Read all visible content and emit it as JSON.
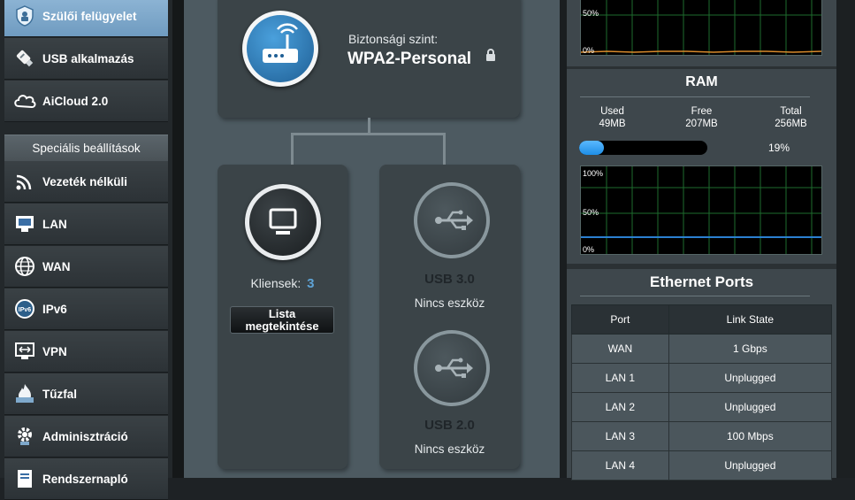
{
  "sidebar": {
    "items": [
      {
        "label": "Szülői felügyelet",
        "icon": "parental-control-icon",
        "active": true
      },
      {
        "label": "USB alkalmazás",
        "icon": "usb-stick-icon"
      },
      {
        "label": "AiCloud 2.0",
        "icon": "cloud-icon"
      }
    ],
    "section_header": "Speciális beállítások",
    "advanced_items": [
      {
        "label": "Vezeték nélküli",
        "icon": "wireless-icon"
      },
      {
        "label": "LAN",
        "icon": "lan-icon"
      },
      {
        "label": "WAN",
        "icon": "globe-icon"
      },
      {
        "label": "IPv6",
        "icon": "ipv6-icon"
      },
      {
        "label": "VPN",
        "icon": "vpn-icon"
      },
      {
        "label": "Tűzfal",
        "icon": "firewall-icon"
      },
      {
        "label": "Adminisztráció",
        "icon": "gear-icon"
      },
      {
        "label": "Rendszernapló",
        "icon": "log-icon"
      }
    ]
  },
  "router_card": {
    "security_label": "Biztonsági szint:",
    "security_value": "WPA2-Personal"
  },
  "clients_card": {
    "clients_label": "Kliensek:",
    "clients_count": "3",
    "view_list_button": "Lista megtekintése"
  },
  "usb_card": {
    "usb3_label": "USB 3.0",
    "usb3_status": "Nincs eszköz",
    "usb2_label": "USB 2.0",
    "usb2_status": "Nincs eszköz"
  },
  "cpu_graph": {
    "label_50": "50%",
    "label_0": "0%"
  },
  "ram": {
    "title": "RAM",
    "used_label": "Used",
    "used_value": "49MB",
    "free_label": "Free",
    "free_value": "207MB",
    "total_label": "Total",
    "total_value": "256MB",
    "usage_percent_text": "19%",
    "usage_fraction": 0.19,
    "graph_label_100": "100%",
    "graph_label_50": "50%",
    "graph_label_0": "0%"
  },
  "ethernet": {
    "title": "Ethernet Ports",
    "col_port": "Port",
    "col_link": "Link State",
    "rows": [
      {
        "port": "WAN",
        "state": "1 Gbps"
      },
      {
        "port": "LAN 1",
        "state": "Unplugged"
      },
      {
        "port": "LAN 2",
        "state": "Unplugged"
      },
      {
        "port": "LAN 3",
        "state": "100 Mbps"
      },
      {
        "port": "LAN 4",
        "state": "Unplugged"
      }
    ]
  },
  "colors": {
    "accent_blue": "#5ea3d6",
    "active_item": "#7ea9cc",
    "ram_bar": "#1e8ee6",
    "graph_line": "#2b7fd0"
  }
}
